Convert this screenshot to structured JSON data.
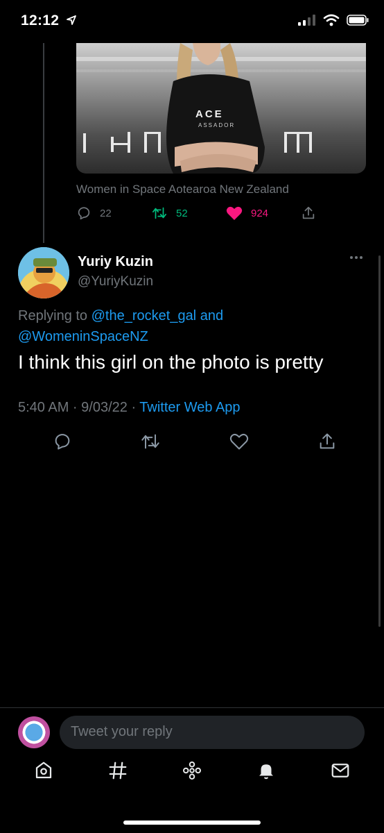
{
  "status_bar": {
    "time": "12:12"
  },
  "quoted": {
    "caption": "Women in Space Aotearoa New Zealand",
    "shirt_text": "ACE",
    "shirt_sub": "ASSADOR",
    "backdrop_text": "Ӄ—л  ш",
    "replies": "22",
    "retweets": "52",
    "likes": "924"
  },
  "reply": {
    "display_name": "Yuriy Kuzin",
    "handle": "@YuriyKuzin",
    "replying_prefix": "Replying to ",
    "mention_1": "@the_rocket_gal",
    "and_word": " and",
    "mention_2": "@WomeninSpaceNZ",
    "text": "I think this girl on the photo is pretty",
    "time": "5:40 AM · 9/03/22 · ",
    "source": "Twitter Web App"
  },
  "composer": {
    "placeholder": "Tweet your reply"
  },
  "colors": {
    "accent": "#1d9bf0",
    "retweet": "#00ba7c",
    "like": "#f91880",
    "muted": "#71767b"
  }
}
